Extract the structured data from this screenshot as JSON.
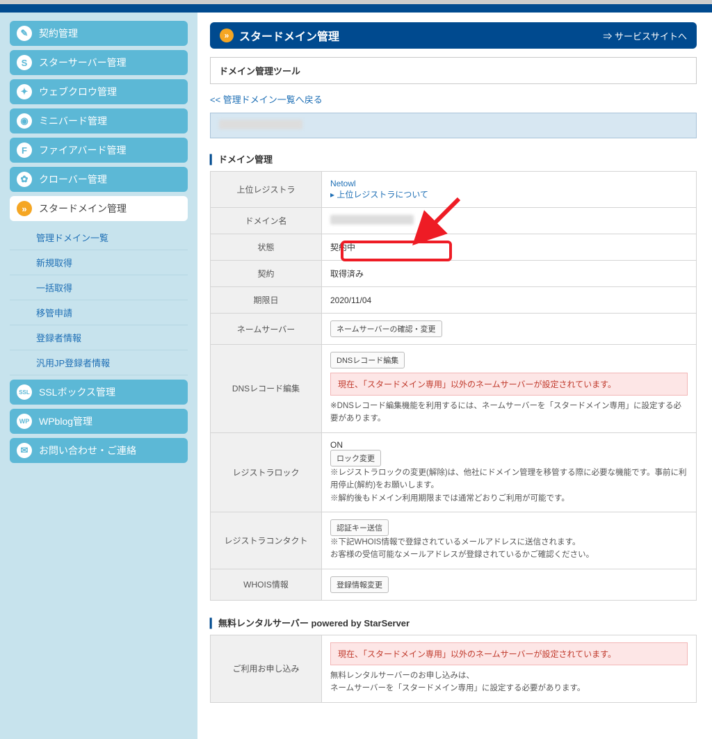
{
  "sidebar": {
    "items": [
      {
        "label": "契約管理",
        "icon": "✎"
      },
      {
        "label": "スターサーバー管理",
        "icon": "S"
      },
      {
        "label": "ウェブクロウ管理",
        "icon": "✦"
      },
      {
        "label": "ミニバード管理",
        "icon": "◉"
      },
      {
        "label": "ファイアバード管理",
        "icon": "F"
      },
      {
        "label": "クローバー管理",
        "icon": "✿"
      }
    ],
    "active": {
      "label": "スタードメイン管理",
      "icon": "»"
    },
    "sub": [
      "管理ドメイン一覧",
      "新規取得",
      "一括取得",
      "移管申請",
      "登録者情報",
      "汎用JP登録者情報"
    ],
    "after": [
      {
        "label": "SSLボックス管理",
        "icon": "SSL"
      },
      {
        "label": "WPblog管理",
        "icon": "WP"
      },
      {
        "label": "お問い合わせ・ご連絡",
        "icon": "✉"
      }
    ]
  },
  "header": {
    "title": "スタードメイン管理",
    "service_link": "⇒ サービスサイトへ"
  },
  "tool_title": "ドメイン管理ツール",
  "back_link": "<< 管理ドメイン一覧へ戻る",
  "section1_title": "ドメイン管理",
  "rows": {
    "registrar": {
      "label": "上位レジストラ",
      "value": "Netowl",
      "sublink": "▸ 上位レジストラについて"
    },
    "domain": {
      "label": "ドメイン名"
    },
    "status": {
      "label": "状態",
      "value": "契約中"
    },
    "contract": {
      "label": "契約",
      "value": "取得済み"
    },
    "expire": {
      "label": "期限日",
      "value": "2020/11/04"
    },
    "nameserver": {
      "label": "ネームサーバー",
      "btn": "ネームサーバーの確認・変更"
    },
    "dns": {
      "label": "DNSレコード編集",
      "btn": "DNSレコード編集",
      "warn": "現在、「スタードメイン専用」以外のネームサーバーが設定されています。",
      "note": "※DNSレコード編集機能を利用するには、ネームサーバーを「スタードメイン専用」に設定する必要があります。"
    },
    "lock": {
      "label": "レジストラロック",
      "status": "ON",
      "btn": "ロック変更",
      "note1": "※レジストラロックの変更(解除)は、他社にドメイン管理を移管する際に必要な機能です。事前に利用停止(解約)をお願いします。",
      "note2": "※解約後もドメイン利用期限までは通常どおりご利用が可能です。"
    },
    "contact": {
      "label": "レジストラコンタクト",
      "btn": "認証キー送信",
      "note1": "※下記WHOIS情報で登録されているメールアドレスに送信されます。",
      "note2": "お客様の受信可能なメールアドレスが登録されているかご確認ください。"
    },
    "whois": {
      "label": "WHOIS情報",
      "btn": "登録情報変更"
    }
  },
  "section2_title": "無料レンタルサーバー powered by StarServer",
  "free": {
    "label": "ご利用お申し込み",
    "warn": "現在、「スタードメイン専用」以外のネームサーバーが設定されています。",
    "note": "無料レンタルサーバーのお申し込みは、\nネームサーバーを「スタードメイン専用」に設定する必要があります。"
  }
}
